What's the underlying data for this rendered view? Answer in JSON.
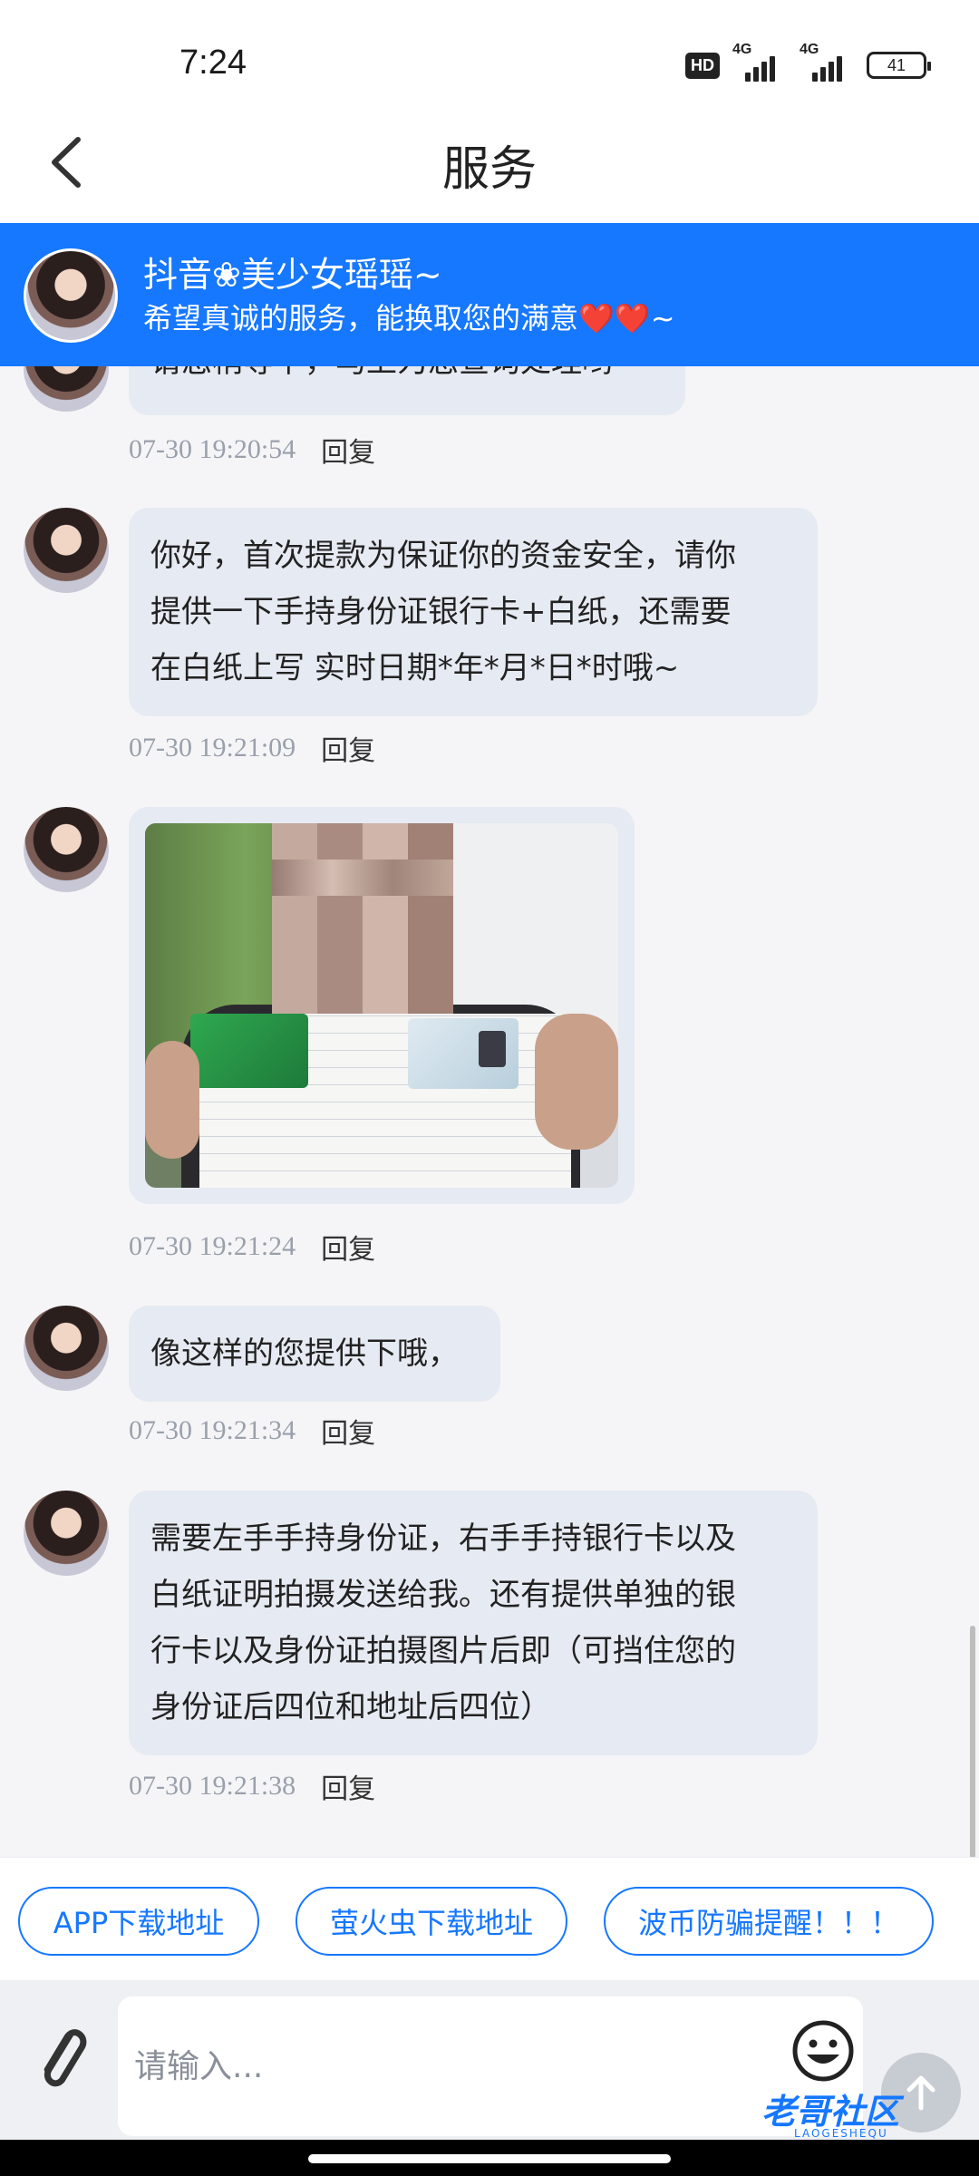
{
  "status_bar": {
    "time": "7:24",
    "hd_badge": "HD",
    "net1": "4G",
    "net2": "4G",
    "battery": "41"
  },
  "header": {
    "title": "服务"
  },
  "banner": {
    "name": "抖音❀美少女瑶瑶~",
    "subtitle": "希望真诚的服务，能换取您的满意❤️❤️~"
  },
  "messages": [
    {
      "text": "请您稍等下，马上为您查询处理哟~",
      "time": "07-30 19:20:54",
      "reply": "回复"
    },
    {
      "lines": [
        "你好，首次提款为保证你的资金安全，请你",
        "提供一下手持身份证银行卡+白纸，还需要",
        "在白纸上写 实时日期*年*月*日*时哦~"
      ],
      "time": "07-30 19:21:09",
      "reply": "回复"
    },
    {
      "image": "photo-id-card-bank-card",
      "time": "07-30 19:21:24",
      "reply": "回复"
    },
    {
      "text": "像这样的您提供下哦，",
      "time": "07-30 19:21:34",
      "reply": "回复"
    },
    {
      "lines": [
        "需要左手手持身份证，右手手持银行卡以及",
        "白纸证明拍摄发送给我。还有提供单独的银",
        "行卡以及身份证拍摄图片后即（可挡住您的",
        "身份证后四位和地址后四位）"
      ],
      "time": "07-30 19:21:38",
      "reply": "回复"
    }
  ],
  "quick_actions": [
    {
      "label": "APP下载地址"
    },
    {
      "label": "萤火虫下载地址"
    },
    {
      "label": "波币防骗提醒！！！"
    }
  ],
  "input": {
    "placeholder": "请输入..."
  },
  "watermark": {
    "text": "老哥社区",
    "sub": "LAOGESHEQU"
  },
  "colors": {
    "accent": "#1677ff",
    "bubble": "#e6eaf2",
    "timestamp": "#9aa0ab"
  }
}
